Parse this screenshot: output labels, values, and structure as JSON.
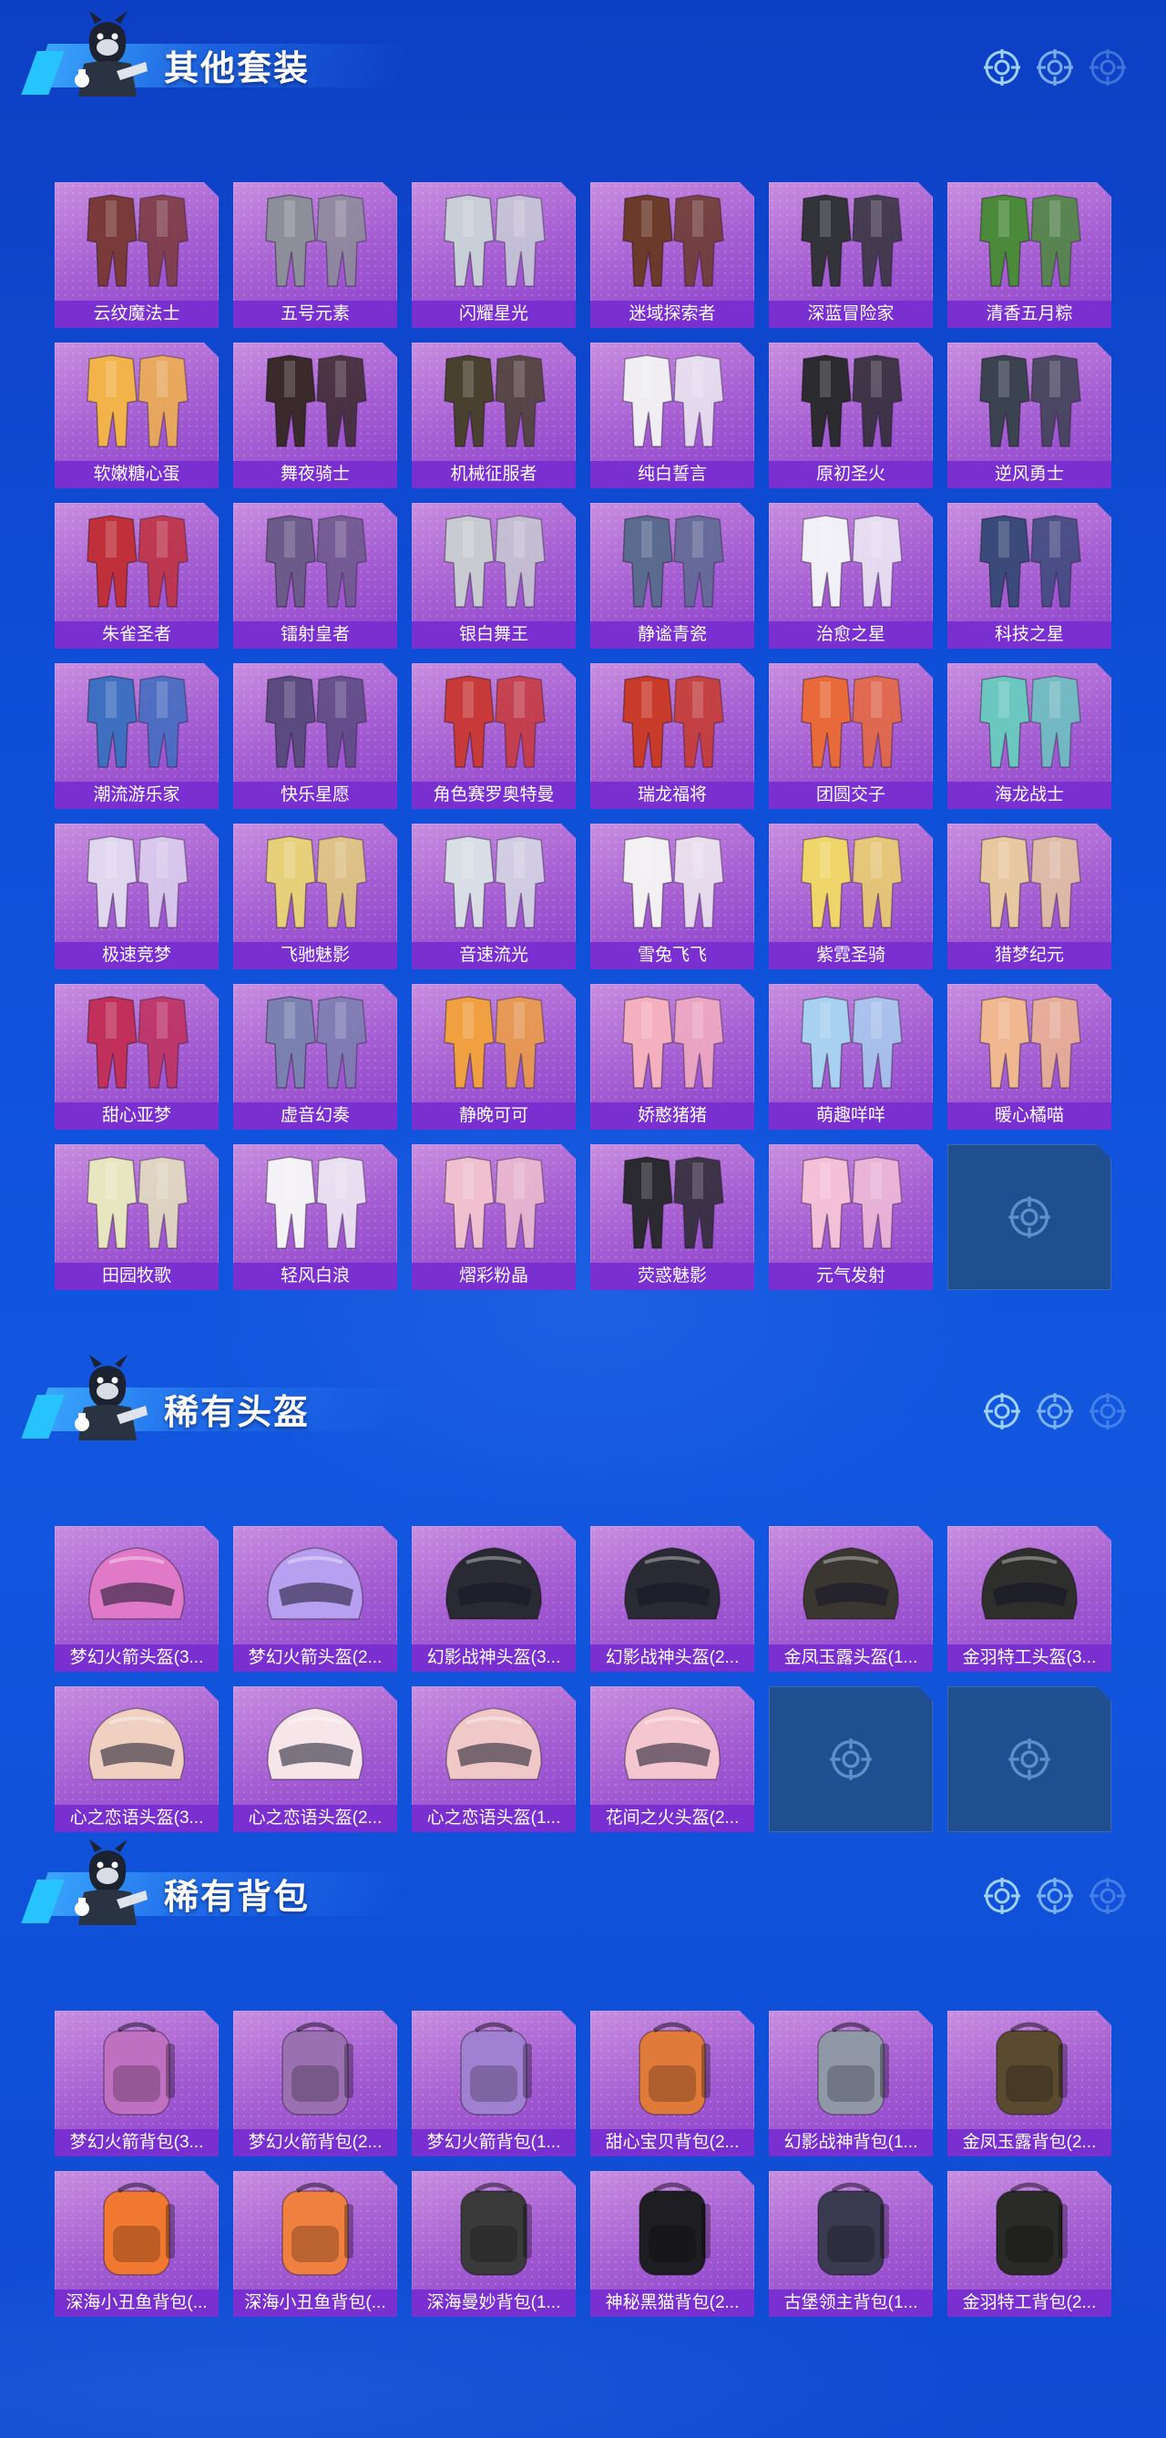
{
  "sections": [
    {
      "title": "其他套装",
      "kind": "suit",
      "items": [
        "云纹魔法士",
        "五号元素",
        "闪耀星光",
        "迷域探索者",
        "深蓝冒险家",
        "清香五月粽",
        "软嫩糖心蛋",
        "舞夜骑士",
        "机械征服者",
        "纯白誓言",
        "原初圣火",
        "逆风勇士",
        "朱雀圣者",
        "镭射皇者",
        "银白舞王",
        "静谧青瓷",
        "治愈之星",
        "科技之星",
        "潮流游乐家",
        "快乐星愿",
        "角色赛罗奥特曼",
        "瑞龙福将",
        "团圆交子",
        "海龙战士",
        "极速竞梦",
        "飞驰魅影",
        "音速流光",
        "雪兔飞飞",
        "紫霓圣骑",
        "猎梦纪元",
        "甜心亚梦",
        "虚音幻奏",
        "静晚可可",
        "娇憨猪猪",
        "萌趣咩咩",
        "暖心橘喵",
        "田园牧歌",
        "轻风白浪",
        "熠彩粉晶",
        "荧惑魅影",
        "元气发射"
      ],
      "colors": [
        "#7a3a3a",
        "#8c8f99",
        "#c9cfd8",
        "#6b3a2a",
        "#33343a",
        "#4b8a3b",
        "#f2b44a",
        "#3a2a2c",
        "#4a4030",
        "#f0eef3",
        "#2c2c30",
        "#3b4250",
        "#c0303a",
        "#6c5a8a",
        "#c8ccd2",
        "#5b6b90",
        "#f0f0f6",
        "#3a4a7a",
        "#3f6fc0",
        "#5a4a80",
        "#c83a3a",
        "#c83a2a",
        "#e86a3a",
        "#6ac8c0",
        "#e0d6f0",
        "#e6d07a",
        "#d8dde6",
        "#f3f0f3",
        "#f0d66a",
        "#e8c8a0",
        "#c0305a",
        "#7a80b0",
        "#f0a040",
        "#f5b0c0",
        "#a8d0f0",
        "#f0b890",
        "#e8e6c0",
        "#f4f2f6",
        "#f0c0d0",
        "#2a2a30",
        "#f4c0d8"
      ],
      "empty_slots": 1
    },
    {
      "title": "稀有头盔",
      "kind": "helmet",
      "items": [
        "梦幻火箭头盔(3...",
        "梦幻火箭头盔(2...",
        "幻影战神头盔(3...",
        "幻影战神头盔(2...",
        "金凤玉露头盔(1...",
        "金羽特工头盔(3...",
        "心之恋语头盔(3...",
        "心之恋语头盔(2...",
        "心之恋语头盔(1...",
        "花间之火头盔(2..."
      ],
      "colors": [
        "#e07ac8",
        "#b8a0f0",
        "#2a2a34",
        "#2a2a34",
        "#3a3630",
        "#2e2e2c",
        "#f0d0c0",
        "#f6e6ea",
        "#f0c8c8",
        "#f4c6d0"
      ],
      "empty_slots": 2
    },
    {
      "title": "稀有背包",
      "kind": "bag",
      "items": [
        "梦幻火箭背包(3...",
        "梦幻火箭背包(2...",
        "梦幻火箭背包(1...",
        "甜心宝贝背包(2...",
        "幻影战神背包(1...",
        "金凤玉露背包(2...",
        "深海小丑鱼背包(...",
        "深海小丑鱼背包(...",
        "深海曼妙背包(1...",
        "神秘黑猫背包(2...",
        "古堡领主背包(1...",
        "金羽特工背包(2..."
      ],
      "colors": [
        "#c070c0",
        "#9a70b0",
        "#a080d0",
        "#e07a3a",
        "#9098a8",
        "#5a4a30",
        "#f07830",
        "#f08040",
        "#3a3a3a",
        "#1e1e22",
        "#3a3a50",
        "#2a2a26"
      ],
      "empty_slots": 0
    }
  ]
}
